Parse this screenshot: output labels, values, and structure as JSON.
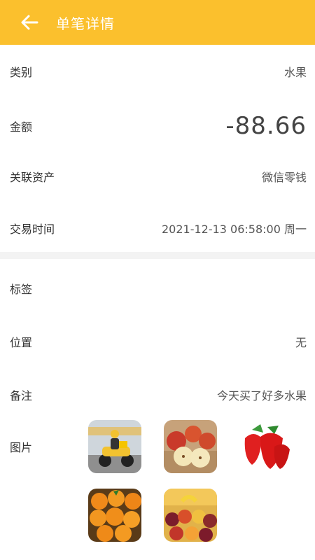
{
  "header": {
    "title": "单笔详情",
    "back_icon": "arrow-left-icon",
    "bg_color": "#fbc02d"
  },
  "details": {
    "category": {
      "label": "类别",
      "value": "水果"
    },
    "amount": {
      "label": "金额",
      "value": "-88.66"
    },
    "account": {
      "label": "关联资产",
      "value": "微信零钱"
    },
    "time": {
      "label": "交易时间",
      "value": "2021-12-13 06:58:00 周一"
    },
    "tags": {
      "label": "标签",
      "value": ""
    },
    "location": {
      "label": "位置",
      "value": "无"
    },
    "note": {
      "label": "备注",
      "value": "今天买了好多水果"
    },
    "images": {
      "label": "图片",
      "items": [
        {
          "name": "delivery-photo"
        },
        {
          "name": "apples-photo"
        },
        {
          "name": "strawberries-photo"
        },
        {
          "name": "oranges-photo"
        },
        {
          "name": "fruit-market-photo"
        }
      ]
    }
  }
}
